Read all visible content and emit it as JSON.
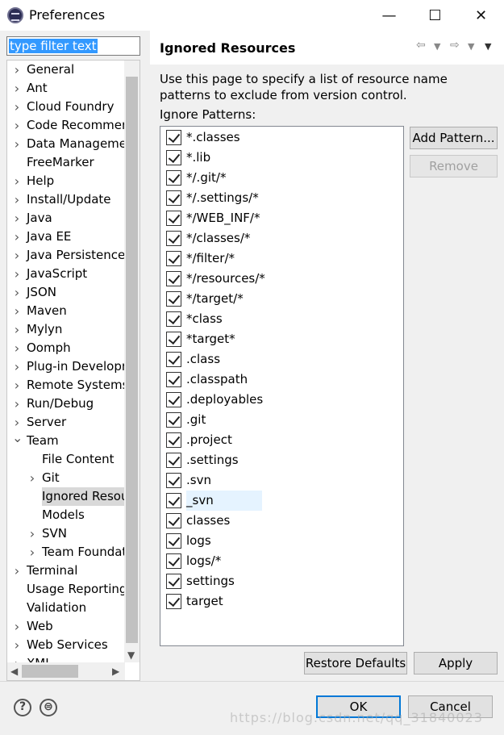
{
  "window": {
    "title": "Preferences",
    "minimize": "—",
    "maximize": "☐",
    "close": "✕"
  },
  "filter": {
    "value": "type filter text"
  },
  "tree": {
    "items": [
      {
        "label": "General",
        "expandable": true,
        "level": 0
      },
      {
        "label": "Ant",
        "expandable": true,
        "level": 0
      },
      {
        "label": "Cloud Foundry",
        "expandable": true,
        "level": 0
      },
      {
        "label": "Code Recommenders",
        "expandable": true,
        "level": 0
      },
      {
        "label": "Data Management",
        "expandable": true,
        "level": 0
      },
      {
        "label": "FreeMarker",
        "expandable": false,
        "level": 0
      },
      {
        "label": "Help",
        "expandable": true,
        "level": 0
      },
      {
        "label": "Install/Update",
        "expandable": true,
        "level": 0
      },
      {
        "label": "Java",
        "expandable": true,
        "level": 0
      },
      {
        "label": "Java EE",
        "expandable": true,
        "level": 0
      },
      {
        "label": "Java Persistence",
        "expandable": true,
        "level": 0
      },
      {
        "label": "JavaScript",
        "expandable": true,
        "level": 0
      },
      {
        "label": "JSON",
        "expandable": true,
        "level": 0
      },
      {
        "label": "Maven",
        "expandable": true,
        "level": 0
      },
      {
        "label": "Mylyn",
        "expandable": true,
        "level": 0
      },
      {
        "label": "Oomph",
        "expandable": true,
        "level": 0
      },
      {
        "label": "Plug-in Development",
        "expandable": true,
        "level": 0
      },
      {
        "label": "Remote Systems",
        "expandable": true,
        "level": 0
      },
      {
        "label": "Run/Debug",
        "expandable": true,
        "level": 0
      },
      {
        "label": "Server",
        "expandable": true,
        "level": 0
      },
      {
        "label": "Team",
        "expandable": true,
        "expanded": true,
        "level": 0
      },
      {
        "label": "File Content",
        "expandable": false,
        "level": 1
      },
      {
        "label": "Git",
        "expandable": true,
        "level": 1
      },
      {
        "label": "Ignored Resources",
        "expandable": false,
        "level": 1,
        "selected": true
      },
      {
        "label": "Models",
        "expandable": false,
        "level": 1
      },
      {
        "label": "SVN",
        "expandable": true,
        "level": 1
      },
      {
        "label": "Team Foundation Server",
        "expandable": true,
        "level": 1
      },
      {
        "label": "Terminal",
        "expandable": true,
        "level": 0
      },
      {
        "label": "Usage Reporting",
        "expandable": false,
        "level": 0
      },
      {
        "label": "Validation",
        "expandable": false,
        "level": 0
      },
      {
        "label": "Web",
        "expandable": true,
        "level": 0
      },
      {
        "label": "Web Services",
        "expandable": true,
        "level": 0
      },
      {
        "label": "XML",
        "expandable": true,
        "level": 0
      }
    ]
  },
  "page": {
    "title": "Ignored Resources",
    "description": "Use this page to specify a list of resource name patterns to exclude from version control.",
    "patterns_label": "Ignore Patterns:",
    "patterns": [
      {
        "text": "*.classes",
        "checked": true
      },
      {
        "text": "*.lib",
        "checked": true
      },
      {
        "text": "*/.git/*",
        "checked": true
      },
      {
        "text": "*/.settings/*",
        "checked": true
      },
      {
        "text": "*/WEB_INF/*",
        "checked": true
      },
      {
        "text": "*/classes/*",
        "checked": true
      },
      {
        "text": "*/filter/*",
        "checked": true
      },
      {
        "text": "*/resources/*",
        "checked": true
      },
      {
        "text": "*/target/*",
        "checked": true
      },
      {
        "text": "*class",
        "checked": true
      },
      {
        "text": "*target*",
        "checked": true
      },
      {
        "text": ".class",
        "checked": true
      },
      {
        "text": ".classpath",
        "checked": true
      },
      {
        "text": ".deployables",
        "checked": true
      },
      {
        "text": ".git",
        "checked": true
      },
      {
        "text": ".project",
        "checked": true
      },
      {
        "text": ".settings",
        "checked": true
      },
      {
        "text": ".svn",
        "checked": true
      },
      {
        "text": "_svn",
        "checked": true,
        "highlighted": true
      },
      {
        "text": "classes",
        "checked": true
      },
      {
        "text": "logs",
        "checked": true
      },
      {
        "text": "logs/*",
        "checked": true
      },
      {
        "text": "settings",
        "checked": true
      },
      {
        "text": "target",
        "checked": true
      }
    ],
    "add_pattern_label": "Add Pattern...",
    "remove_label": "Remove",
    "restore_defaults_label": "Restore Defaults",
    "apply_label": "Apply"
  },
  "footer": {
    "ok_label": "OK",
    "cancel_label": "Cancel",
    "watermark": "https://blog.csdn.net/qq_31840023"
  }
}
